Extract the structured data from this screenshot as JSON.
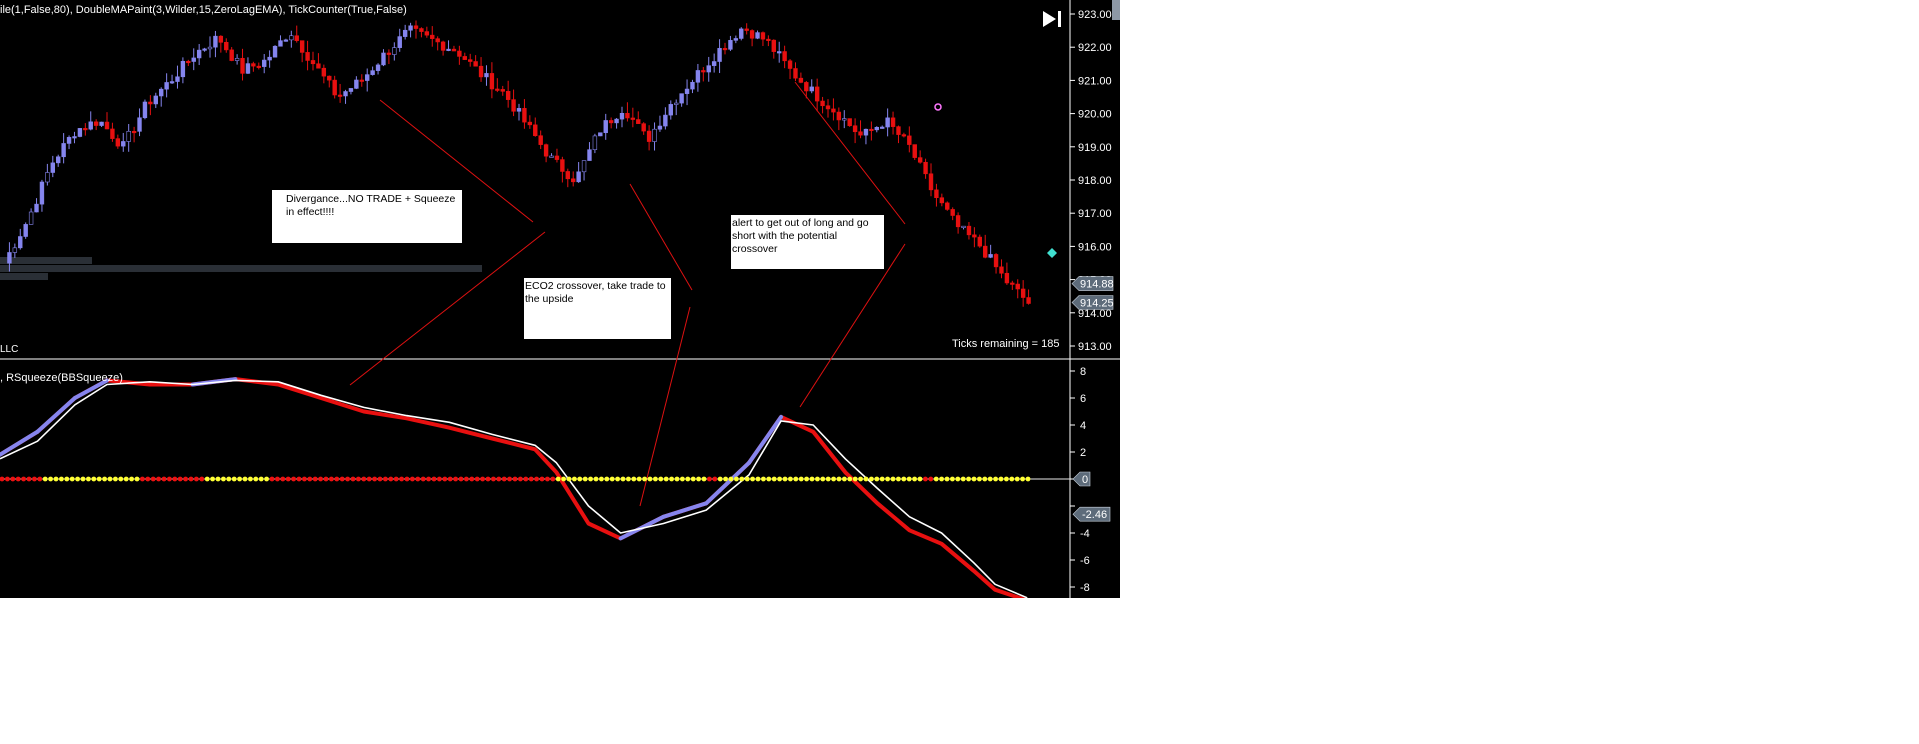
{
  "header": {
    "title": "ile(1,False,80), DoubleMAPaint(3,Wilder,15,ZeroLagEMA), TickCounter(True,False)",
    "vendor_tag": "LLC"
  },
  "upper_panel": {
    "price_labels": [
      "923.00",
      "922.00",
      "921.00",
      "920.00",
      "919.00",
      "918.00",
      "917.00",
      "916.00",
      "915.00",
      "914.00",
      "913.00"
    ],
    "badge_ask": "914.88",
    "badge_last": "914.25",
    "ticks_text": "Ticks remaining = 185",
    "bull_color": "#8585ee",
    "bear_color": "#e81010"
  },
  "lower_panel": {
    "title": ", RSqueeze(BBSqueeze)",
    "axis_labels": [
      "8",
      "6",
      "4",
      "2",
      "0",
      "-2",
      "-4",
      "-6",
      "-8"
    ],
    "zero_badge": "0",
    "value_badge": "-2.46"
  },
  "notes": [
    {
      "text": "Divergance...NO TRADE + Squeeze in effect!!!!"
    },
    {
      "text": "ECO2 crossover, take trade to the upside"
    },
    {
      "text": "alert to get out of long and go short with the potential crossover"
    }
  ],
  "chart_data": [
    {
      "type": "candlestick",
      "title": "",
      "ylim": [
        913.0,
        923.0
      ],
      "last_price": 914.25,
      "ask_price": 914.88,
      "close_path": [
        915.5,
        916.8,
        918.5,
        919.5,
        919.8,
        919.0,
        920.3,
        921.0,
        921.8,
        922.3,
        921.3,
        921.6,
        922.5,
        921.5,
        920.5,
        921.0,
        921.8,
        922.5,
        922.2,
        921.9,
        921.2,
        920.6,
        919.6,
        918.6,
        918.0,
        919.5,
        920.2,
        919.2,
        920.3,
        921.1,
        921.9,
        922.6,
        922.2,
        921.3,
        920.6,
        920.0,
        919.3,
        919.8,
        919.0,
        917.6,
        916.6,
        916.0,
        915.0,
        914.3
      ],
      "bar_count": 190,
      "markers": [
        {
          "label": "diamond",
          "price": 915.8
        }
      ]
    },
    {
      "type": "line",
      "title": "",
      "ylim": [
        -8,
        8
      ],
      "x": [
        0,
        0.035,
        0.07,
        0.1,
        0.14,
        0.18,
        0.22,
        0.26,
        0.3,
        0.34,
        0.38,
        0.42,
        0.46,
        0.5,
        0.52,
        0.55,
        0.58,
        0.62,
        0.66,
        0.7,
        0.73,
        0.76,
        0.79,
        0.82,
        0.85,
        0.88,
        0.91,
        0.93,
        0.96
      ],
      "series": [
        {
          "values": [
            1.8,
            3.5,
            6.0,
            7.3,
            7.0,
            7.0,
            7.4,
            7.0,
            6.0,
            5.0,
            4.5,
            3.8,
            3.0,
            2.2,
            0.5,
            -3.3,
            -4.4,
            -2.8,
            -1.8,
            1.2,
            4.6,
            3.5,
            0.5,
            -1.8,
            -3.8,
            -4.8,
            -6.8,
            -8.2,
            -9.0
          ]
        },
        {
          "values": [
            1.5,
            2.8,
            5.5,
            7.0,
            7.2,
            7.0,
            7.3,
            7.2,
            6.2,
            5.3,
            4.7,
            4.2,
            3.3,
            2.5,
            1.2,
            -2.0,
            -4.0,
            -3.3,
            -2.3,
            0.3,
            4.3,
            4.0,
            1.5,
            -0.7,
            -2.8,
            -4.0,
            -6.2,
            -7.8,
            -8.8
          ]
        }
      ],
      "squeeze_dots_segments": [
        {
          "from": 0,
          "to": 0.04,
          "state": "red"
        },
        {
          "from": 0.04,
          "to": 0.13,
          "state": "yellow"
        },
        {
          "from": 0.13,
          "to": 0.19,
          "state": "red"
        },
        {
          "from": 0.19,
          "to": 0.25,
          "state": "yellow"
        },
        {
          "from": 0.25,
          "to": 0.52,
          "state": "red"
        },
        {
          "from": 0.52,
          "to": 0.66,
          "state": "yellow"
        },
        {
          "from": 0.66,
          "to": 0.67,
          "state": "red"
        },
        {
          "from": 0.67,
          "to": 0.86,
          "state": "yellow"
        },
        {
          "from": 0.86,
          "to": 0.87,
          "state": "red"
        },
        {
          "from": 0.87,
          "to": 0.965,
          "state": "yellow"
        }
      ]
    }
  ]
}
